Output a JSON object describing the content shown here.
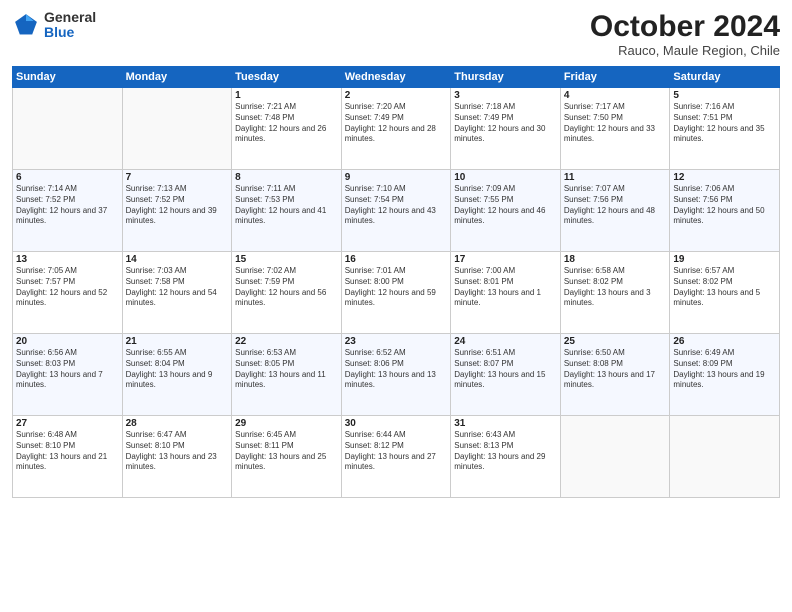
{
  "header": {
    "logo": {
      "general": "General",
      "blue": "Blue"
    },
    "title": "October 2024",
    "subtitle": "Rauco, Maule Region, Chile"
  },
  "weekdays": [
    "Sunday",
    "Monday",
    "Tuesday",
    "Wednesday",
    "Thursday",
    "Friday",
    "Saturday"
  ],
  "weeks": [
    [
      {
        "day": "",
        "sunrise": "",
        "sunset": "",
        "daylight": ""
      },
      {
        "day": "",
        "sunrise": "",
        "sunset": "",
        "daylight": ""
      },
      {
        "day": "1",
        "sunrise": "Sunrise: 7:21 AM",
        "sunset": "Sunset: 7:48 PM",
        "daylight": "Daylight: 12 hours and 26 minutes."
      },
      {
        "day": "2",
        "sunrise": "Sunrise: 7:20 AM",
        "sunset": "Sunset: 7:49 PM",
        "daylight": "Daylight: 12 hours and 28 minutes."
      },
      {
        "day": "3",
        "sunrise": "Sunrise: 7:18 AM",
        "sunset": "Sunset: 7:49 PM",
        "daylight": "Daylight: 12 hours and 30 minutes."
      },
      {
        "day": "4",
        "sunrise": "Sunrise: 7:17 AM",
        "sunset": "Sunset: 7:50 PM",
        "daylight": "Daylight: 12 hours and 33 minutes."
      },
      {
        "day": "5",
        "sunrise": "Sunrise: 7:16 AM",
        "sunset": "Sunset: 7:51 PM",
        "daylight": "Daylight: 12 hours and 35 minutes."
      }
    ],
    [
      {
        "day": "6",
        "sunrise": "Sunrise: 7:14 AM",
        "sunset": "Sunset: 7:52 PM",
        "daylight": "Daylight: 12 hours and 37 minutes."
      },
      {
        "day": "7",
        "sunrise": "Sunrise: 7:13 AM",
        "sunset": "Sunset: 7:52 PM",
        "daylight": "Daylight: 12 hours and 39 minutes."
      },
      {
        "day": "8",
        "sunrise": "Sunrise: 7:11 AM",
        "sunset": "Sunset: 7:53 PM",
        "daylight": "Daylight: 12 hours and 41 minutes."
      },
      {
        "day": "9",
        "sunrise": "Sunrise: 7:10 AM",
        "sunset": "Sunset: 7:54 PM",
        "daylight": "Daylight: 12 hours and 43 minutes."
      },
      {
        "day": "10",
        "sunrise": "Sunrise: 7:09 AM",
        "sunset": "Sunset: 7:55 PM",
        "daylight": "Daylight: 12 hours and 46 minutes."
      },
      {
        "day": "11",
        "sunrise": "Sunrise: 7:07 AM",
        "sunset": "Sunset: 7:56 PM",
        "daylight": "Daylight: 12 hours and 48 minutes."
      },
      {
        "day": "12",
        "sunrise": "Sunrise: 7:06 AM",
        "sunset": "Sunset: 7:56 PM",
        "daylight": "Daylight: 12 hours and 50 minutes."
      }
    ],
    [
      {
        "day": "13",
        "sunrise": "Sunrise: 7:05 AM",
        "sunset": "Sunset: 7:57 PM",
        "daylight": "Daylight: 12 hours and 52 minutes."
      },
      {
        "day": "14",
        "sunrise": "Sunrise: 7:03 AM",
        "sunset": "Sunset: 7:58 PM",
        "daylight": "Daylight: 12 hours and 54 minutes."
      },
      {
        "day": "15",
        "sunrise": "Sunrise: 7:02 AM",
        "sunset": "Sunset: 7:59 PM",
        "daylight": "Daylight: 12 hours and 56 minutes."
      },
      {
        "day": "16",
        "sunrise": "Sunrise: 7:01 AM",
        "sunset": "Sunset: 8:00 PM",
        "daylight": "Daylight: 12 hours and 59 minutes."
      },
      {
        "day": "17",
        "sunrise": "Sunrise: 7:00 AM",
        "sunset": "Sunset: 8:01 PM",
        "daylight": "Daylight: 13 hours and 1 minute."
      },
      {
        "day": "18",
        "sunrise": "Sunrise: 6:58 AM",
        "sunset": "Sunset: 8:02 PM",
        "daylight": "Daylight: 13 hours and 3 minutes."
      },
      {
        "day": "19",
        "sunrise": "Sunrise: 6:57 AM",
        "sunset": "Sunset: 8:02 PM",
        "daylight": "Daylight: 13 hours and 5 minutes."
      }
    ],
    [
      {
        "day": "20",
        "sunrise": "Sunrise: 6:56 AM",
        "sunset": "Sunset: 8:03 PM",
        "daylight": "Daylight: 13 hours and 7 minutes."
      },
      {
        "day": "21",
        "sunrise": "Sunrise: 6:55 AM",
        "sunset": "Sunset: 8:04 PM",
        "daylight": "Daylight: 13 hours and 9 minutes."
      },
      {
        "day": "22",
        "sunrise": "Sunrise: 6:53 AM",
        "sunset": "Sunset: 8:05 PM",
        "daylight": "Daylight: 13 hours and 11 minutes."
      },
      {
        "day": "23",
        "sunrise": "Sunrise: 6:52 AM",
        "sunset": "Sunset: 8:06 PM",
        "daylight": "Daylight: 13 hours and 13 minutes."
      },
      {
        "day": "24",
        "sunrise": "Sunrise: 6:51 AM",
        "sunset": "Sunset: 8:07 PM",
        "daylight": "Daylight: 13 hours and 15 minutes."
      },
      {
        "day": "25",
        "sunrise": "Sunrise: 6:50 AM",
        "sunset": "Sunset: 8:08 PM",
        "daylight": "Daylight: 13 hours and 17 minutes."
      },
      {
        "day": "26",
        "sunrise": "Sunrise: 6:49 AM",
        "sunset": "Sunset: 8:09 PM",
        "daylight": "Daylight: 13 hours and 19 minutes."
      }
    ],
    [
      {
        "day": "27",
        "sunrise": "Sunrise: 6:48 AM",
        "sunset": "Sunset: 8:10 PM",
        "daylight": "Daylight: 13 hours and 21 minutes."
      },
      {
        "day": "28",
        "sunrise": "Sunrise: 6:47 AM",
        "sunset": "Sunset: 8:10 PM",
        "daylight": "Daylight: 13 hours and 23 minutes."
      },
      {
        "day": "29",
        "sunrise": "Sunrise: 6:45 AM",
        "sunset": "Sunset: 8:11 PM",
        "daylight": "Daylight: 13 hours and 25 minutes."
      },
      {
        "day": "30",
        "sunrise": "Sunrise: 6:44 AM",
        "sunset": "Sunset: 8:12 PM",
        "daylight": "Daylight: 13 hours and 27 minutes."
      },
      {
        "day": "31",
        "sunrise": "Sunrise: 6:43 AM",
        "sunset": "Sunset: 8:13 PM",
        "daylight": "Daylight: 13 hours and 29 minutes."
      },
      {
        "day": "",
        "sunrise": "",
        "sunset": "",
        "daylight": ""
      },
      {
        "day": "",
        "sunrise": "",
        "sunset": "",
        "daylight": ""
      }
    ]
  ]
}
